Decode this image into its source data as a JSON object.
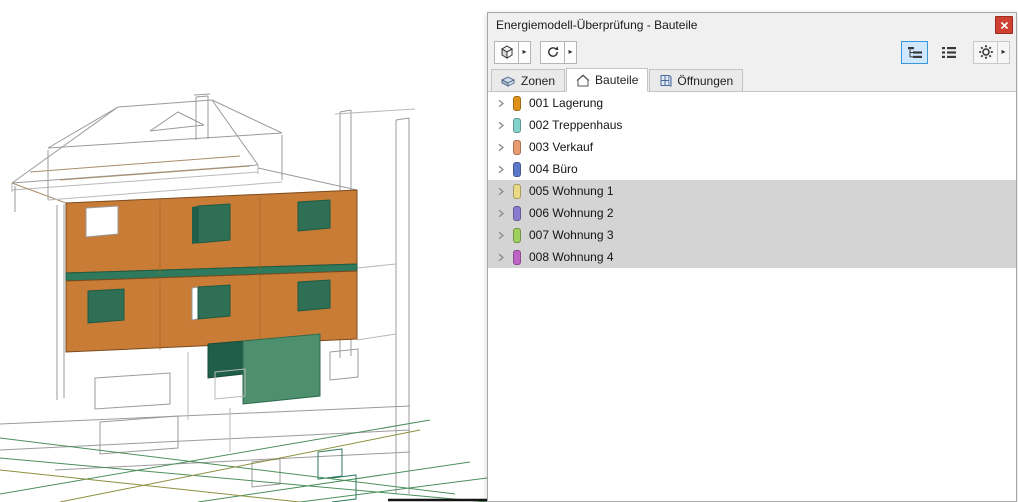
{
  "window": {
    "title": "Energiemodell-Überprüfung - Bauteile"
  },
  "tabs": [
    {
      "label": "Zonen",
      "active": false
    },
    {
      "label": "Bauteile",
      "active": true
    },
    {
      "label": "Öffnungen",
      "active": false
    }
  ],
  "list": {
    "items": [
      {
        "label": "001 Lagerung",
        "color": "#df921a",
        "selected": false
      },
      {
        "label": "002 Treppenhaus",
        "color": "#82d2cc",
        "selected": false
      },
      {
        "label": "003 Verkauf",
        "color": "#e89a70",
        "selected": false
      },
      {
        "label": "004 Büro",
        "color": "#5c78c8",
        "selected": false
      },
      {
        "label": "005 Wohnung 1",
        "color": "#ead985",
        "selected": true
      },
      {
        "label": "006 Wohnung 2",
        "color": "#8a7ad0",
        "selected": true
      },
      {
        "label": "007 Wohnung 3",
        "color": "#9fcf5f",
        "selected": true
      },
      {
        "label": "008 Wohnung 4",
        "color": "#bf63c6",
        "selected": true
      }
    ]
  },
  "icons": {
    "model_3d_button": "cube-icon",
    "update_button": "refresh-icon",
    "tree_view_button": "tree-view-icon",
    "list_view_button": "list-view-icon",
    "settings_button": "gear-icon",
    "close_button": "close-x-icon",
    "tab_zonen": "zones-icon",
    "tab_bauteile": "house-icon",
    "tab_oeffnungen": "opening-icon",
    "row_expander": "chevron-right-icon",
    "dropdown": "▸"
  },
  "colors": {
    "selection_background": "#d4d4d4",
    "active_toggle_background": "#cfe8ff",
    "active_toggle_border": "#3a96dd",
    "close_button_red": "#cf4233"
  },
  "scene": {
    "facade_color": "#c87c36",
    "facade_edge_color": "#7c4b1d",
    "window_glass_color": "#2e6f56",
    "floor_band_color": "#2f7a5c",
    "roof_deck_color": "#4e8f6d",
    "roof_deck_dark_color": "#1f5f4a"
  }
}
